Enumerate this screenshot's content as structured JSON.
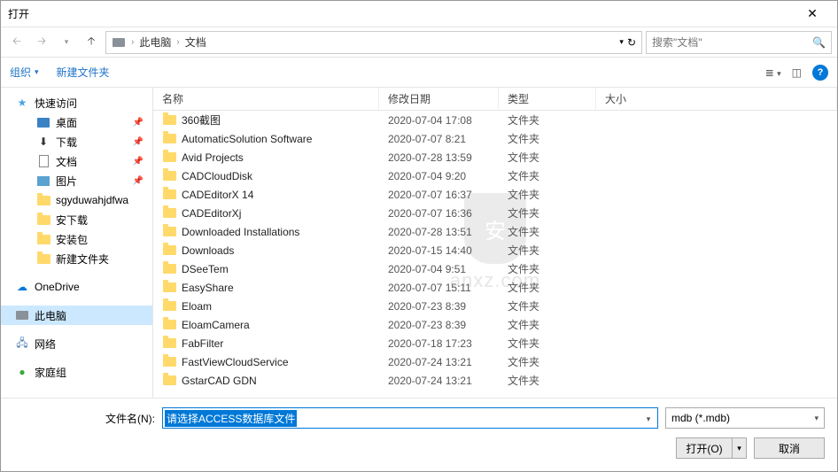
{
  "title": "打开",
  "breadcrumb": {
    "pc": "此电脑",
    "docs": "文档"
  },
  "search_placeholder": "搜索\"文档\"",
  "toolbar": {
    "organize": "组织",
    "newfolder": "新建文件夹"
  },
  "sidebar": {
    "quick": "快速访问",
    "desktop": "桌面",
    "downloads": "下载",
    "documents": "文档",
    "pictures": "图片",
    "f1": "sgyduwahjdfwa",
    "f2": "安下载",
    "f3": "安装包",
    "f4": "新建文件夹",
    "onedrive": "OneDrive",
    "thispc": "此电脑",
    "network": "网络",
    "homegroup": "家庭组"
  },
  "cols": {
    "name": "名称",
    "date": "修改日期",
    "type": "类型",
    "size": "大小"
  },
  "type_folder": "文件夹",
  "files": [
    {
      "name": "360截图",
      "date": "2020-07-04 17:08"
    },
    {
      "name": "AutomaticSolution Software",
      "date": "2020-07-07 8:21"
    },
    {
      "name": "Avid Projects",
      "date": "2020-07-28 13:59"
    },
    {
      "name": "CADCloudDisk",
      "date": "2020-07-04 9:20"
    },
    {
      "name": "CADEditorX 14",
      "date": "2020-07-07 16:37"
    },
    {
      "name": "CADEditorXj",
      "date": "2020-07-07 16:36"
    },
    {
      "name": "Downloaded Installations",
      "date": "2020-07-28 13:51"
    },
    {
      "name": "Downloads",
      "date": "2020-07-15 14:40"
    },
    {
      "name": "DSeeTem",
      "date": "2020-07-04 9:51"
    },
    {
      "name": "EasyShare",
      "date": "2020-07-07 15:11"
    },
    {
      "name": "Eloam",
      "date": "2020-07-23 8:39"
    },
    {
      "name": "EloamCamera",
      "date": "2020-07-23 8:39"
    },
    {
      "name": "FabFilter",
      "date": "2020-07-18 17:23"
    },
    {
      "name": "FastViewCloudService",
      "date": "2020-07-24 13:21"
    },
    {
      "name": "GstarCAD GDN",
      "date": "2020-07-24 13:21"
    }
  ],
  "footer": {
    "filename_label": "文件名(N):",
    "filename_value": "请选择ACCESS数据库文件",
    "filter": "mdb (*.mdb)",
    "open": "打开(O)",
    "cancel": "取消"
  },
  "watermark": "anxz.com"
}
